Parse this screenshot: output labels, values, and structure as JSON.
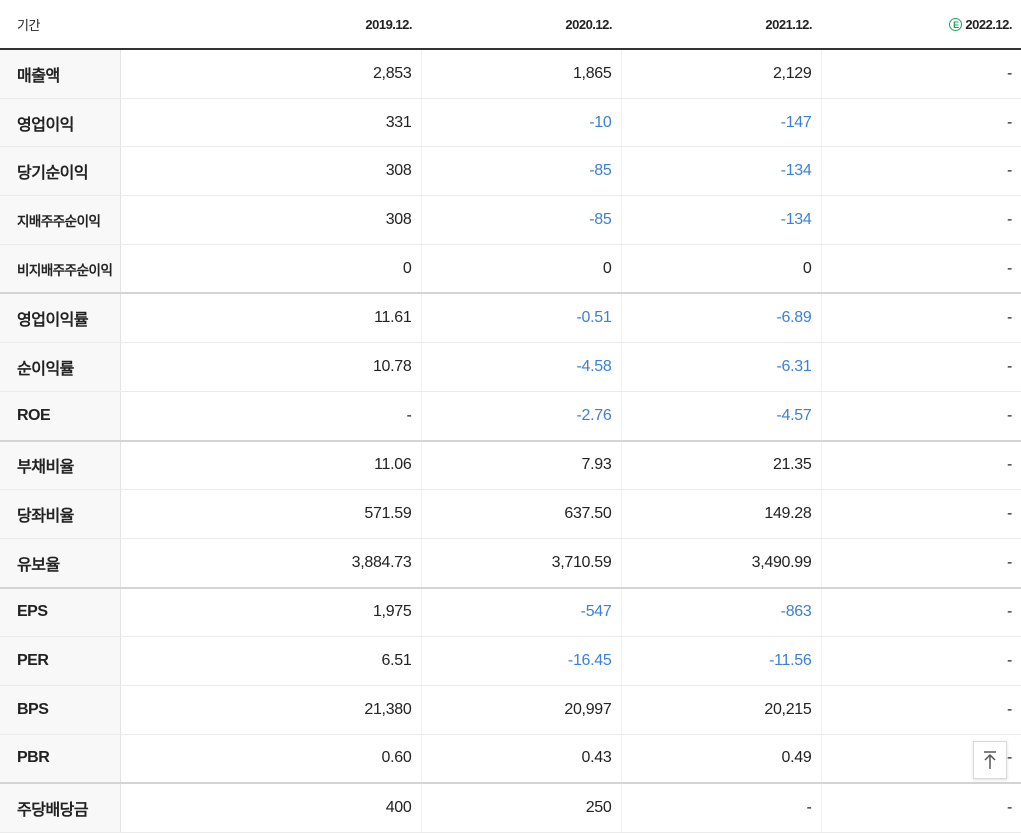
{
  "header": {
    "label": "기간",
    "periods": [
      "2019.12.",
      "2020.12.",
      "2021.12.",
      "2022.12."
    ],
    "estimate_badge": "E",
    "estimate_color": "#1aa55a"
  },
  "colors": {
    "negative": "#3b80d6"
  },
  "rows": [
    {
      "label": "매출액",
      "values": [
        "2,853",
        "1,865",
        "2,129",
        "-"
      ]
    },
    {
      "label": "영업이익",
      "values": [
        "331",
        "-10",
        "-147",
        "-"
      ]
    },
    {
      "label": "당기순이익",
      "values": [
        "308",
        "-85",
        "-134",
        "-"
      ]
    },
    {
      "label": "지배주주순이익",
      "values": [
        "308",
        "-85",
        "-134",
        "-"
      ]
    },
    {
      "label": "비지배주주순이익",
      "values": [
        "0",
        "0",
        "0",
        "-"
      ]
    },
    {
      "label": "영업이익률",
      "values": [
        "11.61",
        "-0.51",
        "-6.89",
        "-"
      ]
    },
    {
      "label": "순이익률",
      "values": [
        "10.78",
        "-4.58",
        "-6.31",
        "-"
      ]
    },
    {
      "label": "ROE",
      "values": [
        "-",
        "-2.76",
        "-4.57",
        "-"
      ]
    },
    {
      "label": "부채비율",
      "values": [
        "11.06",
        "7.93",
        "21.35",
        "-"
      ]
    },
    {
      "label": "당좌비율",
      "values": [
        "571.59",
        "637.50",
        "149.28",
        "-"
      ]
    },
    {
      "label": "유보율",
      "values": [
        "3,884.73",
        "3,710.59",
        "3,490.99",
        "-"
      ]
    },
    {
      "label": "EPS",
      "values": [
        "1,975",
        "-547",
        "-863",
        "-"
      ]
    },
    {
      "label": "PER",
      "values": [
        "6.51",
        "-16.45",
        "-11.56",
        "-"
      ]
    },
    {
      "label": "BPS",
      "values": [
        "21,380",
        "20,997",
        "20,215",
        "-"
      ]
    },
    {
      "label": "PBR",
      "values": [
        "0.60",
        "0.43",
        "0.49",
        "-"
      ]
    },
    {
      "label": "주당배당금",
      "values": [
        "400",
        "250",
        "-",
        "-"
      ]
    }
  ],
  "scroll_top": {
    "icon": "arrow-up-to-top-icon"
  }
}
